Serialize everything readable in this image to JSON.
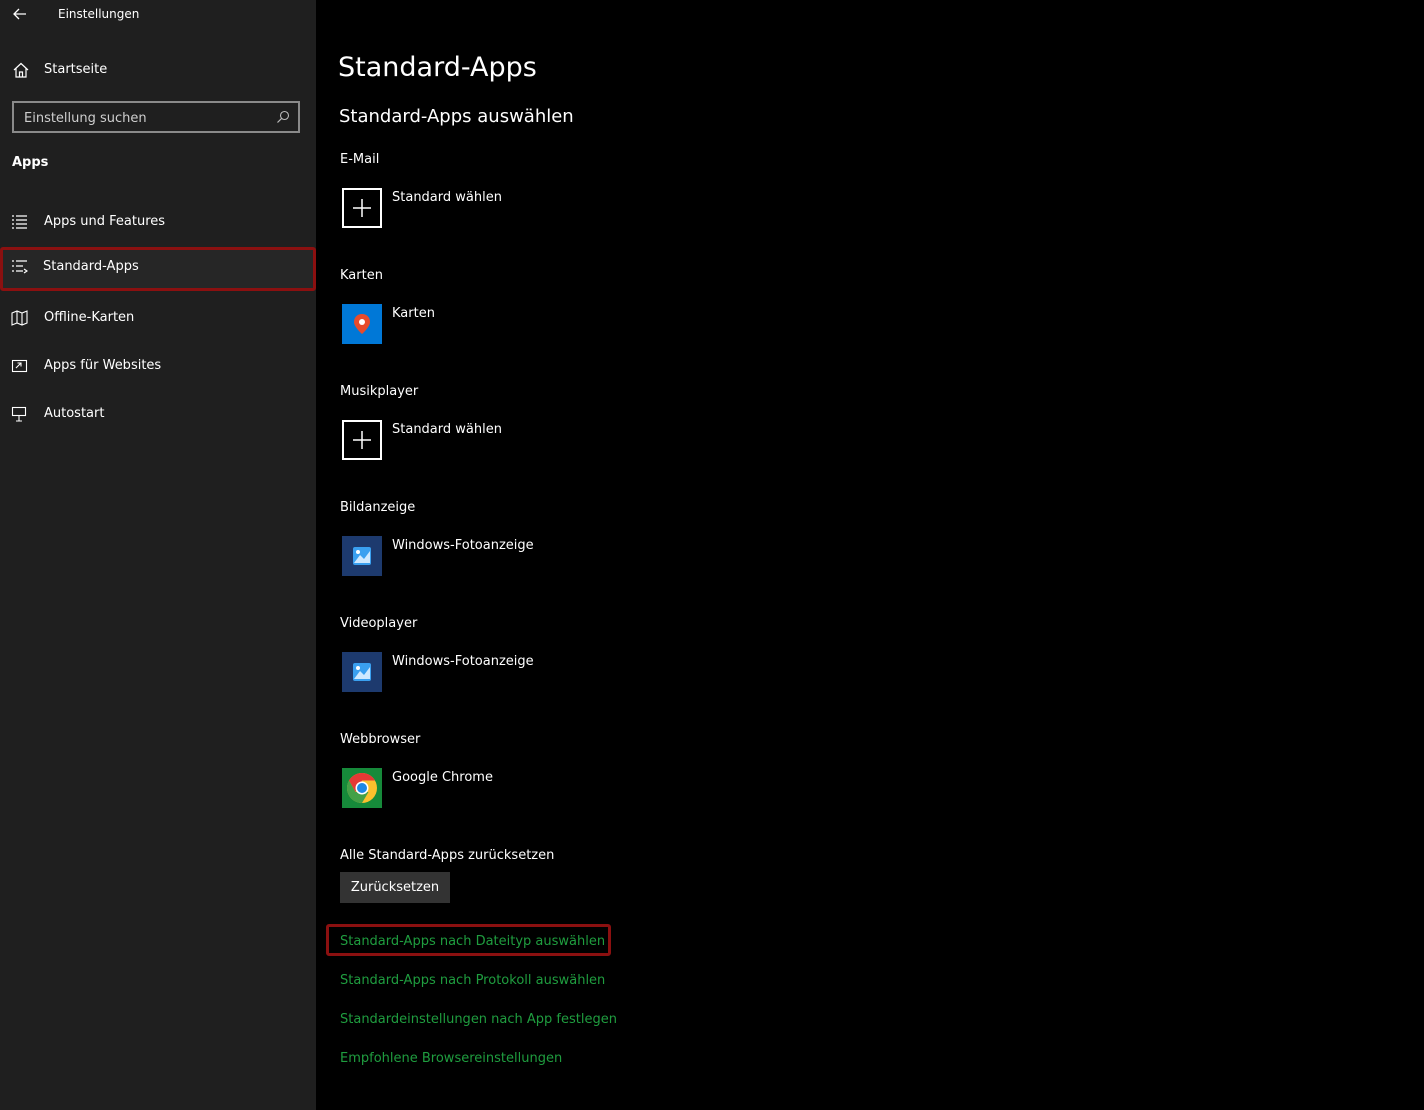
{
  "window": {
    "title": "Einstellungen"
  },
  "sidebar": {
    "home_label": "Startseite",
    "search_placeholder": "Einstellung suchen",
    "section": "Apps",
    "items": [
      {
        "label": "Apps und Features",
        "icon": "list-icon"
      },
      {
        "label": "Standard-Apps",
        "icon": "default-apps-icon",
        "selected": true
      },
      {
        "label": "Offline-Karten",
        "icon": "map-icon"
      },
      {
        "label": "Apps für Websites",
        "icon": "open-in-app-icon"
      },
      {
        "label": "Autostart",
        "icon": "startup-icon"
      }
    ]
  },
  "main": {
    "title": "Standard-Apps",
    "subtitle": "Standard-Apps auswählen",
    "categories": [
      {
        "label": "E-Mail",
        "app": "Standard wählen",
        "icon": "plus-icon"
      },
      {
        "label": "Karten",
        "app": "Karten",
        "icon": "maps-app-icon"
      },
      {
        "label": "Musikplayer",
        "app": "Standard wählen",
        "icon": "plus-icon"
      },
      {
        "label": "Bildanzeige",
        "app": "Windows-Fotoanzeige",
        "icon": "photo-viewer-icon"
      },
      {
        "label": "Videoplayer",
        "app": "Windows-Fotoanzeige",
        "icon": "photo-viewer-icon"
      },
      {
        "label": "Webbrowser",
        "app": "Google Chrome",
        "icon": "chrome-icon"
      }
    ],
    "reset": {
      "label": "Alle Standard-Apps zurücksetzen",
      "button": "Zurücksetzen"
    },
    "links": [
      "Standard-Apps nach Dateityp auswählen",
      "Standard-Apps nach Protokoll auswählen",
      "Standardeinstellungen nach App festlegen",
      "Empfohlene Browsereinstellungen"
    ]
  },
  "colors": {
    "sidebar_bg": "#1f1f1f",
    "main_bg": "#000000",
    "link": "#1f9d3f",
    "highlight_border": "#8b1010",
    "button_bg": "#333333"
  }
}
